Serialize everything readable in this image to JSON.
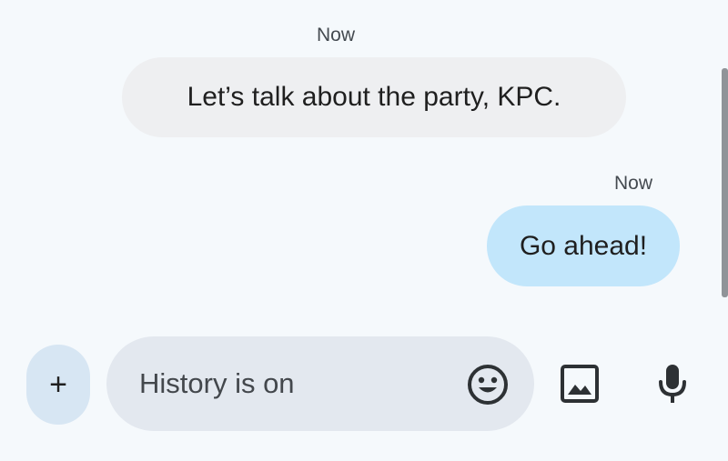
{
  "messages": [
    {
      "timestamp": "Now",
      "direction": "incoming",
      "text": "Let’s talk about the party, KPC."
    },
    {
      "timestamp": "Now",
      "direction": "outgoing",
      "text": "Go ahead!"
    }
  ],
  "composer": {
    "add_label": "+",
    "placeholder": "History is on",
    "emoji_icon": "smiley-face-icon",
    "gallery_icon": "image-gallery-icon",
    "mic_icon": "microphone-icon"
  },
  "colors": {
    "background": "#f5f9fc",
    "incoming_bubble": "#eeeff1",
    "outgoing_bubble": "#c2e6fb",
    "compose_field": "#e3e8ef",
    "add_button": "#d7e6f3",
    "icon": "#2d3134"
  }
}
